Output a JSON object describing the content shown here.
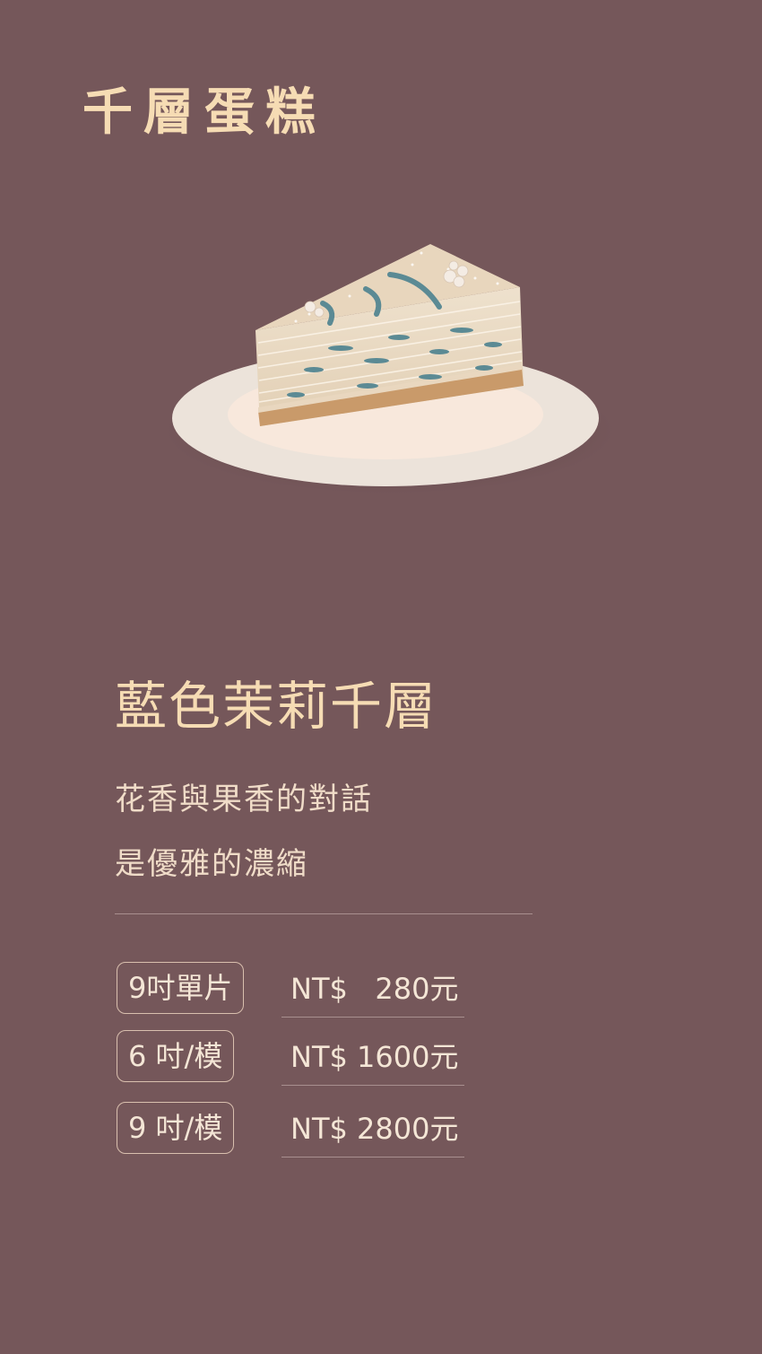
{
  "header": {
    "title": "千層蛋糕"
  },
  "product": {
    "name": "藍色茉莉千層",
    "tagline_1": "花香與果香的對話",
    "tagline_2": "是優雅的濃縮",
    "image_icon": "cake-slice-illustration"
  },
  "prices": [
    {
      "size": "9吋單片",
      "price": "NT$   280元"
    },
    {
      "size": "6 吋/模",
      "price": "NT$ 1600元"
    },
    {
      "size": "9 吋/模",
      "price": "NT$ 2800元"
    }
  ],
  "colors": {
    "background": "#75575a",
    "title": "#f6dcb4",
    "text": "#f4e6d6",
    "accent_blue": "#5b8a94"
  }
}
